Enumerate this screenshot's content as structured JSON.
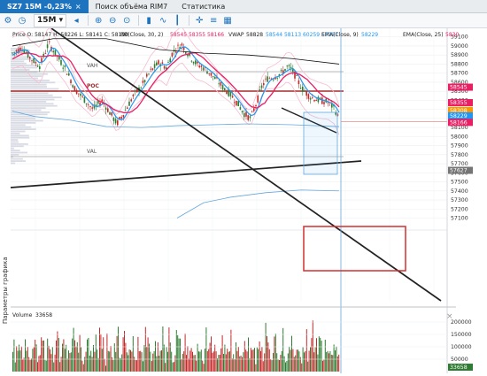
{
  "tabs": [
    {
      "label": "SZ7 15M -0,23%",
      "active": true,
      "close": "×"
    },
    {
      "label": "Поиск объёма RIM7"
    },
    {
      "label": "Статистика"
    }
  ],
  "toolbar": {
    "timeframe": "15M",
    "icons": [
      "settings-icon",
      "clock-icon",
      "timeframe-dropdown",
      "zoom-in-icon",
      "zoom-out-icon",
      "zoom-fit-icon",
      "bar-chart-icon",
      "line-chart-icon",
      "candles-icon",
      "crosshair-icon",
      "fib-icon",
      "calendar-icon",
      "arrow-icon"
    ]
  },
  "legend": {
    "text1": "Price O: 58147 H: 58226 L: 58141 C: 58190",
    "bb_label": "BB(Close, 30, 2)",
    "bb_values": "58545  58355  58166",
    "vwap_label": "VWAP",
    "vwap_value": "58828",
    "v2": "58544  58113  60259  57397",
    "ema9_label": "EMA(Close, 9)",
    "ema9_value": "58229",
    "ema25_label": "EMA(Close, 25)",
    "ema25_value": "5830"
  },
  "profile_labels": {
    "vah": "VAH",
    "poc": "POC",
    "val": "VAL"
  },
  "price_axis": [
    "59100",
    "59000",
    "58900",
    "58800",
    "58700",
    "58600",
    "58500",
    "58400",
    "58300",
    "58200",
    "58100",
    "58000",
    "57900",
    "57800",
    "57700",
    "57600",
    "57500",
    "57400",
    "57300",
    "57200",
    "57100"
  ],
  "price_tags": [
    {
      "text": "58545",
      "color": "#e91e63"
    },
    {
      "text": "58355",
      "color": "#e91e63"
    },
    {
      "text": "58308",
      "color": "#ff9800"
    },
    {
      "text": "58229",
      "color": "#2196f3"
    },
    {
      "text": "58166",
      "color": "#e91e63"
    },
    {
      "text": "57627",
      "color": "#757575"
    }
  ],
  "volume": {
    "label": "Volume",
    "value": "33658",
    "axis": [
      "200000",
      "150000",
      "100000",
      "50000"
    ],
    "tag": "33658"
  },
  "side_label": "Параметры графика",
  "close_icon": "×",
  "colors": {
    "accent": "#1e73be",
    "poc": "#a52a2a",
    "ema_fast": "#e91e63",
    "ema_slow": "#2196f3",
    "bull": "#2e7d32",
    "bear": "#c62828",
    "box": "#d32f2f"
  }
}
